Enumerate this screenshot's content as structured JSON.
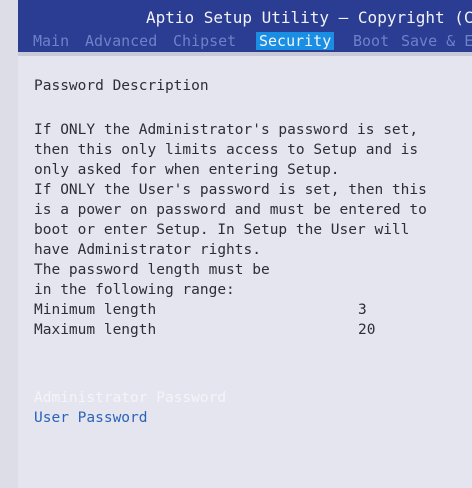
{
  "header": {
    "title": "Aptio Setup Utility – Copyright (C)"
  },
  "menu": {
    "tabs": [
      {
        "label": "Main"
      },
      {
        "label": "Advanced"
      },
      {
        "label": "Chipset"
      },
      {
        "label": "Security"
      },
      {
        "label": "Boot"
      },
      {
        "label": "Save & E"
      }
    ],
    "active": "Security"
  },
  "content": {
    "heading": "Password Description",
    "description": [
      "If ONLY the Administrator's password is set,",
      "then this only limits access to Setup and is",
      "only asked for when entering Setup.",
      "If ONLY the User's password is set, then this",
      "is a power on password and must be entered to",
      "boot or enter Setup. In Setup the User will",
      "have Administrator rights.",
      "The password length must be",
      "in the following range:"
    ],
    "min_label": "Minimum length",
    "min_value": "3",
    "max_label": "Maximum length",
    "max_value": "20"
  },
  "items": {
    "admin_password": "Administrator Password",
    "user_password": "User Password"
  },
  "colors": {
    "header_bg": "#2b3c93",
    "active_tab": "#1a8ee3",
    "link": "#2a63b8"
  }
}
